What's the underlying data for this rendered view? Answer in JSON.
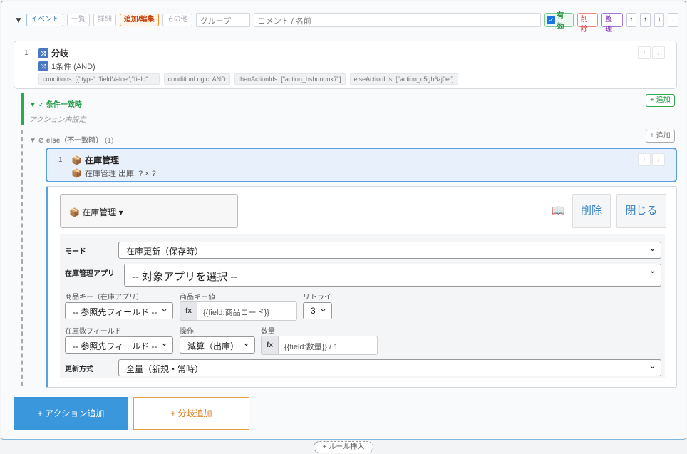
{
  "topbar": {
    "caret": "▼",
    "tags": [
      "イベント",
      "一覧",
      "詳細",
      "追加/編集",
      "その他"
    ],
    "group_placeholder": "グループ",
    "comment_placeholder": "コメント / 名前",
    "enabled_label": "有効",
    "delete_label": "削除",
    "organize_label": "整理",
    "arrows": [
      "↑",
      "↑",
      "↓",
      "↓"
    ]
  },
  "branch": {
    "index": "1",
    "icon_glyph": "⤨",
    "title": "分岐",
    "subtitle": "1条件 (AND)",
    "chips": [
      "conditions: [{\"type\":\"fieldValue\",\"field\":...",
      "conditionLogic: AND",
      "thenActionIds: [\"action_hshqnqok7\"]",
      "elseActionIds: [\"action_c5gh6zj0e\"]"
    ],
    "up": "↑",
    "down": "↓"
  },
  "true_branch": {
    "title": "▼ ✓ 条件一致時",
    "empty": "アクション未設定",
    "add_label": "+ 追加"
  },
  "else_branch": {
    "title": "▼ ⊘ else（不一致時）",
    "count": "(1)",
    "add_label": "+ 追加"
  },
  "action": {
    "index": "1",
    "icon_glyph": "📦",
    "title": "在庫管理",
    "subtitle": "在庫管理 出庫: ? × ?",
    "up": "↑",
    "down": "↓"
  },
  "editor": {
    "type_label": "📦 在庫管理 ▾",
    "book_glyph": "📖",
    "delete_label": "削除",
    "close_label": "閉じる",
    "mode_label": "モード",
    "mode_value": "在庫更新（保存時）",
    "app_label": "在庫管理アプリ",
    "app_value": "-- 対象アプリを選択 --",
    "key_label": "商品キー（在庫アプリ）",
    "key_value": "-- 参照先フィールド --",
    "keyval_label": "商品キー値",
    "keyval_fx": "fx",
    "keyval_value": "{{field:商品コード}}",
    "retry_label": "リトライ",
    "retry_value": "3",
    "stock_label": "在庫数フィールド",
    "stock_value": "-- 参照先フィールド --",
    "op_label": "操作",
    "op_value": "減算（出庫）",
    "qty_label": "数量",
    "qty_fx": "fx",
    "qty_value": "{{field:数量}} / 1",
    "update_label": "更新方式",
    "update_value": "全量（新規・常時）"
  },
  "buttons": {
    "add_action": "+ アクション追加",
    "add_branch": "+ 分岐追加",
    "rule_insert": "+ ルール挿入"
  }
}
